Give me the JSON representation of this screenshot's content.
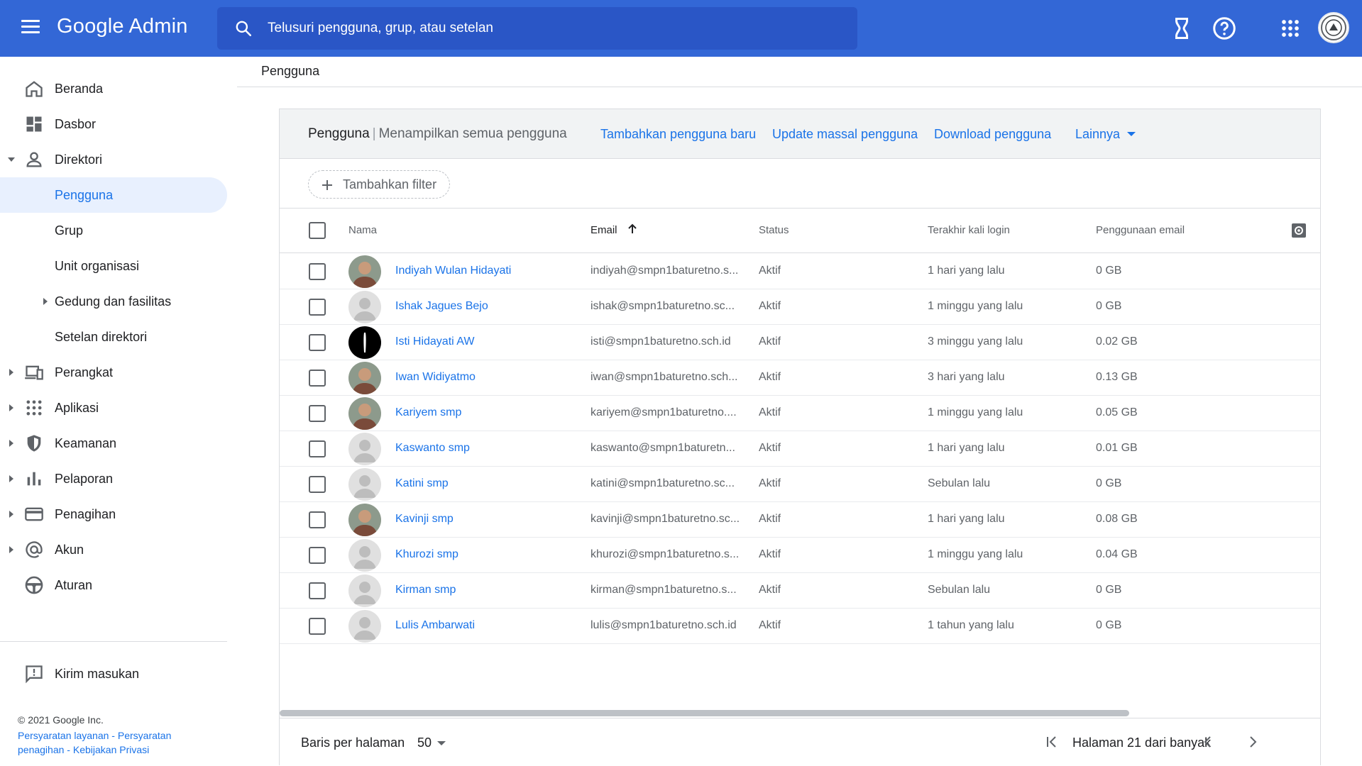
{
  "app": {
    "title": "Google Admin"
  },
  "search": {
    "placeholder": "Telusuri pengguna, grup, atau setelan"
  },
  "topbar_icons": [
    "menu-icon",
    "hourglass-icon",
    "help-icon",
    "apps-grid-icon",
    "account-avatar"
  ],
  "sidebar": {
    "items": [
      {
        "label": "Beranda",
        "icon": "home-icon"
      },
      {
        "label": "Dasbor",
        "icon": "dashboard-icon"
      },
      {
        "label": "Direktori",
        "icon": "person-icon"
      },
      {
        "label": "Pengguna"
      },
      {
        "label": "Grup"
      },
      {
        "label": "Unit organisasi"
      },
      {
        "label": "Gedung dan fasilitas"
      },
      {
        "label": "Setelan direktori"
      },
      {
        "label": "Perangkat",
        "icon": "devices-icon"
      },
      {
        "label": "Aplikasi",
        "icon": "apps-icon"
      },
      {
        "label": "Keamanan",
        "icon": "shield-icon"
      },
      {
        "label": "Pelaporan",
        "icon": "bar-chart-icon"
      },
      {
        "label": "Penagihan",
        "icon": "credit-card-icon"
      },
      {
        "label": "Akun",
        "icon": "at-sign-icon"
      },
      {
        "label": "Aturan",
        "icon": "steering-icon"
      }
    ],
    "feedback": "Kirim masukan",
    "copyright": "© 2021 Google Inc.",
    "links": [
      "Persyaratan layanan",
      "Persyaratan penagihan",
      "Kebijakan Privasi"
    ]
  },
  "breadcrumb": "Pengguna",
  "card": {
    "title": "Pengguna",
    "subtitle": "Menampilkan semua pengguna",
    "actions": [
      "Tambahkan pengguna baru",
      "Update massal pengguna",
      "Download pengguna",
      "Lainnya"
    ],
    "filter_label": "Tambahkan filter"
  },
  "table": {
    "columns": [
      "Nama",
      "Email",
      "Status",
      "Terakhir kali login",
      "Penggunaan email"
    ],
    "rows": [
      {
        "name": "Indiyah Wulan Hidayati",
        "email": "indiyah@smpn1baturetno.s...",
        "status": "Aktif",
        "login": "1 hari yang lalu",
        "usage": "0 GB",
        "avatar": "photo"
      },
      {
        "name": "Ishak Jagues Bejo",
        "email": "ishak@smpn1baturetno.sc...",
        "status": "Aktif",
        "login": "1 minggu yang lalu",
        "usage": "0 GB",
        "avatar": "default"
      },
      {
        "name": "Isti Hidayati AW",
        "email": "isti@smpn1baturetno.sch.id",
        "status": "Aktif",
        "login": "3 minggu yang lalu",
        "usage": "0.02 GB",
        "avatar": "dark"
      },
      {
        "name": "Iwan Widiyatmo",
        "email": "iwan@smpn1baturetno.sch...",
        "status": "Aktif",
        "login": "3 hari yang lalu",
        "usage": "0.13 GB",
        "avatar": "photo"
      },
      {
        "name": "Kariyem smp",
        "email": "kariyem@smpn1baturetno....",
        "status": "Aktif",
        "login": "1 minggu yang lalu",
        "usage": "0.05 GB",
        "avatar": "photo"
      },
      {
        "name": "Kaswanto smp",
        "email": "kaswanto@smpn1baturetn...",
        "status": "Aktif",
        "login": "1 hari yang lalu",
        "usage": "0.01 GB",
        "avatar": "default"
      },
      {
        "name": "Katini smp",
        "email": "katini@smpn1baturetno.sc...",
        "status": "Aktif",
        "login": "Sebulan lalu",
        "usage": "0 GB",
        "avatar": "default"
      },
      {
        "name": "Kavinji smp",
        "email": "kavinji@smpn1baturetno.sc...",
        "status": "Aktif",
        "login": "1 hari yang lalu",
        "usage": "0.08 GB",
        "avatar": "photo"
      },
      {
        "name": "Khurozi smp",
        "email": "khurozi@smpn1baturetno.s...",
        "status": "Aktif",
        "login": "1 minggu yang lalu",
        "usage": "0.04 GB",
        "avatar": "default"
      },
      {
        "name": "Kirman smp",
        "email": "kirman@smpn1baturetno.s...",
        "status": "Aktif",
        "login": "Sebulan lalu",
        "usage": "0 GB",
        "avatar": "default"
      },
      {
        "name": "Lulis Ambarwati",
        "email": "lulis@smpn1baturetno.sch.id",
        "status": "Aktif",
        "login": "1 tahun yang lalu",
        "usage": "0 GB",
        "avatar": "default"
      }
    ]
  },
  "footer": {
    "rows_per_page_label": "Baris per halaman",
    "rows_per_page": "50",
    "page_text": "Halaman 21 dari banyak"
  },
  "colors": {
    "topbar": "#3367d6",
    "accent": "#1a73e8",
    "active_bg": "#e8f0fe"
  }
}
